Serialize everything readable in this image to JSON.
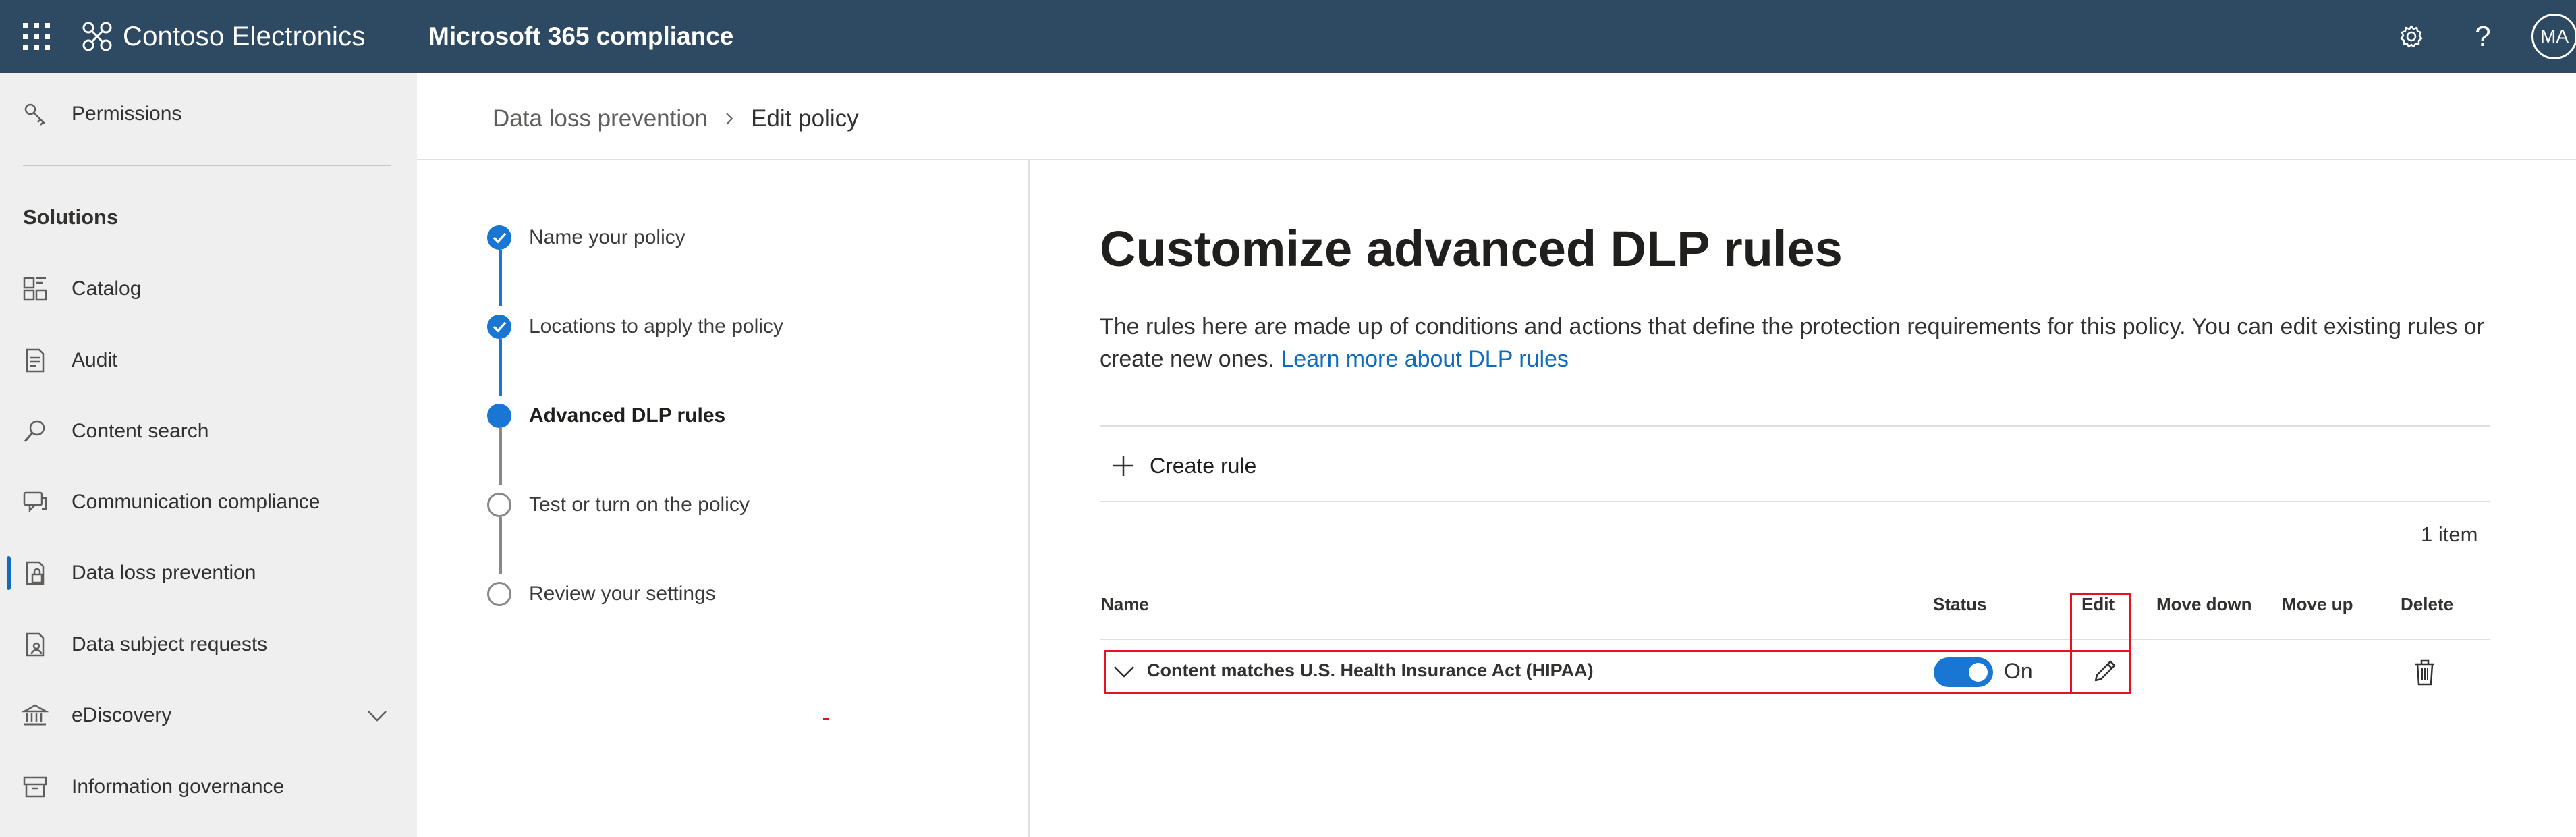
{
  "topbar": {
    "brand": "Contoso Electronics",
    "app_title": "Microsoft 365 compliance",
    "avatar_initials": "MA",
    "help_glyph": "?"
  },
  "sidebar": {
    "section_title": "Solutions",
    "items": [
      {
        "label": "Permissions",
        "icon": "key-icon"
      },
      {
        "label": "Catalog",
        "icon": "catalog-icon"
      },
      {
        "label": "Audit",
        "icon": "audit-icon"
      },
      {
        "label": "Content search",
        "icon": "search-icon"
      },
      {
        "label": "Communication compliance",
        "icon": "chat-icon"
      },
      {
        "label": "Data loss prevention",
        "icon": "dlp-icon",
        "active": true
      },
      {
        "label": "Data subject requests",
        "icon": "data-request-icon"
      },
      {
        "label": "eDiscovery",
        "icon": "ediscovery-icon",
        "expandable": true
      },
      {
        "label": "Information governance",
        "icon": "governance-icon"
      }
    ]
  },
  "breadcrumb": {
    "parent": "Data loss prevention",
    "current": "Edit policy"
  },
  "steps": [
    {
      "label": "Name your policy",
      "state": "done"
    },
    {
      "label": "Locations to apply the policy",
      "state": "done"
    },
    {
      "label": "Advanced DLP rules",
      "state": "current"
    },
    {
      "label": "Test or turn on the policy",
      "state": "todo"
    },
    {
      "label": "Review your settings",
      "state": "todo"
    }
  ],
  "main": {
    "title": "Customize advanced DLP rules",
    "description": "The rules here are made up of conditions and actions that define the protection requirements for this policy. You can edit existing rules or create new ones.",
    "learn_more": "Learn more about DLP rules",
    "create_rule": "Create rule",
    "item_count": "1 item",
    "columns": {
      "name": "Name",
      "status": "Status",
      "edit": "Edit",
      "move_down": "Move down",
      "move_up": "Move up",
      "delete": "Delete"
    },
    "rows": [
      {
        "name": "Content matches U.S. Health Insurance Act (HIPAA)",
        "status_label": "On",
        "status_on": true
      }
    ]
  },
  "colors": {
    "topbar": "#2e4a63",
    "accent": "#1976d2",
    "highlight": "#e81123",
    "sidebar_bg": "#efefef"
  }
}
